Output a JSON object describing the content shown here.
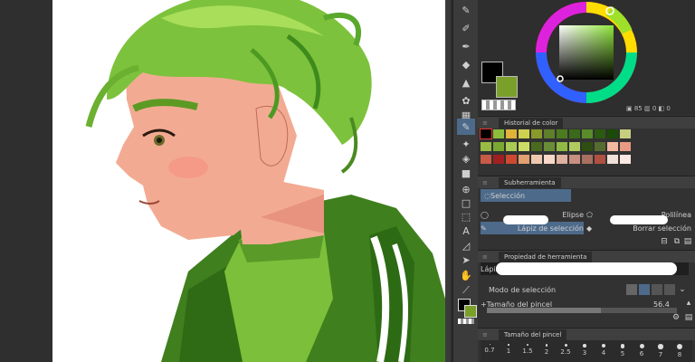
{
  "color_wheel": {
    "readout_value_a": "85",
    "readout_value_b": "0",
    "readout_value_c": "0"
  },
  "color_history": {
    "title": "Historial de color",
    "swatches": [
      "#000000",
      "#8bbd3a",
      "#e0b23a",
      "#d0d050",
      "#8a9a2a",
      "#5f7f2a",
      "#4c7a1e",
      "#3a6a1a",
      "#5a8c2a",
      "#2c5a10",
      "#1b4a0a",
      "#c8d080",
      "#99bb44",
      "#7aa831",
      "#aacc55",
      "#ccdd66",
      "#4a6a20",
      "#6a8c36",
      "#8fb845",
      "#b0cc60",
      "#2e4e12",
      "#556b2f",
      "#f4b8a0",
      "#e89a85",
      "#c85a48",
      "#a02020",
      "#d04830",
      "#e0a070",
      "#f0c8b0",
      "#f8d8c8",
      "#e0b0a0",
      "#c89080",
      "#a87060",
      "#b05040",
      "#f0e0d8",
      "#fce8e0"
    ]
  },
  "subtool": {
    "title": "Subherramienta",
    "group_label": "Selección",
    "items": [
      {
        "label": "Elipse"
      },
      {
        "label": "Polilínea"
      },
      {
        "label": "Lápiz de selección"
      },
      {
        "label": "Borrar selección"
      }
    ]
  },
  "tool_property": {
    "title": "Propiedad de herramienta",
    "tool_name": "Lápiz de selección",
    "mode_label": "Modo de selección",
    "brush_size_label": "Tamaño del pincel",
    "brush_size_value": "56.4"
  },
  "brush_size_panel": {
    "title": "Tamaño del pincel",
    "sizes": [
      "0.7",
      "1",
      "1.5",
      "2",
      "2.5",
      "3",
      "4",
      "5",
      "6",
      "7",
      "8"
    ]
  },
  "colors": {
    "main_color": "#000000",
    "sub_color": "#7aa02a",
    "accent": "#4d6a8a"
  }
}
